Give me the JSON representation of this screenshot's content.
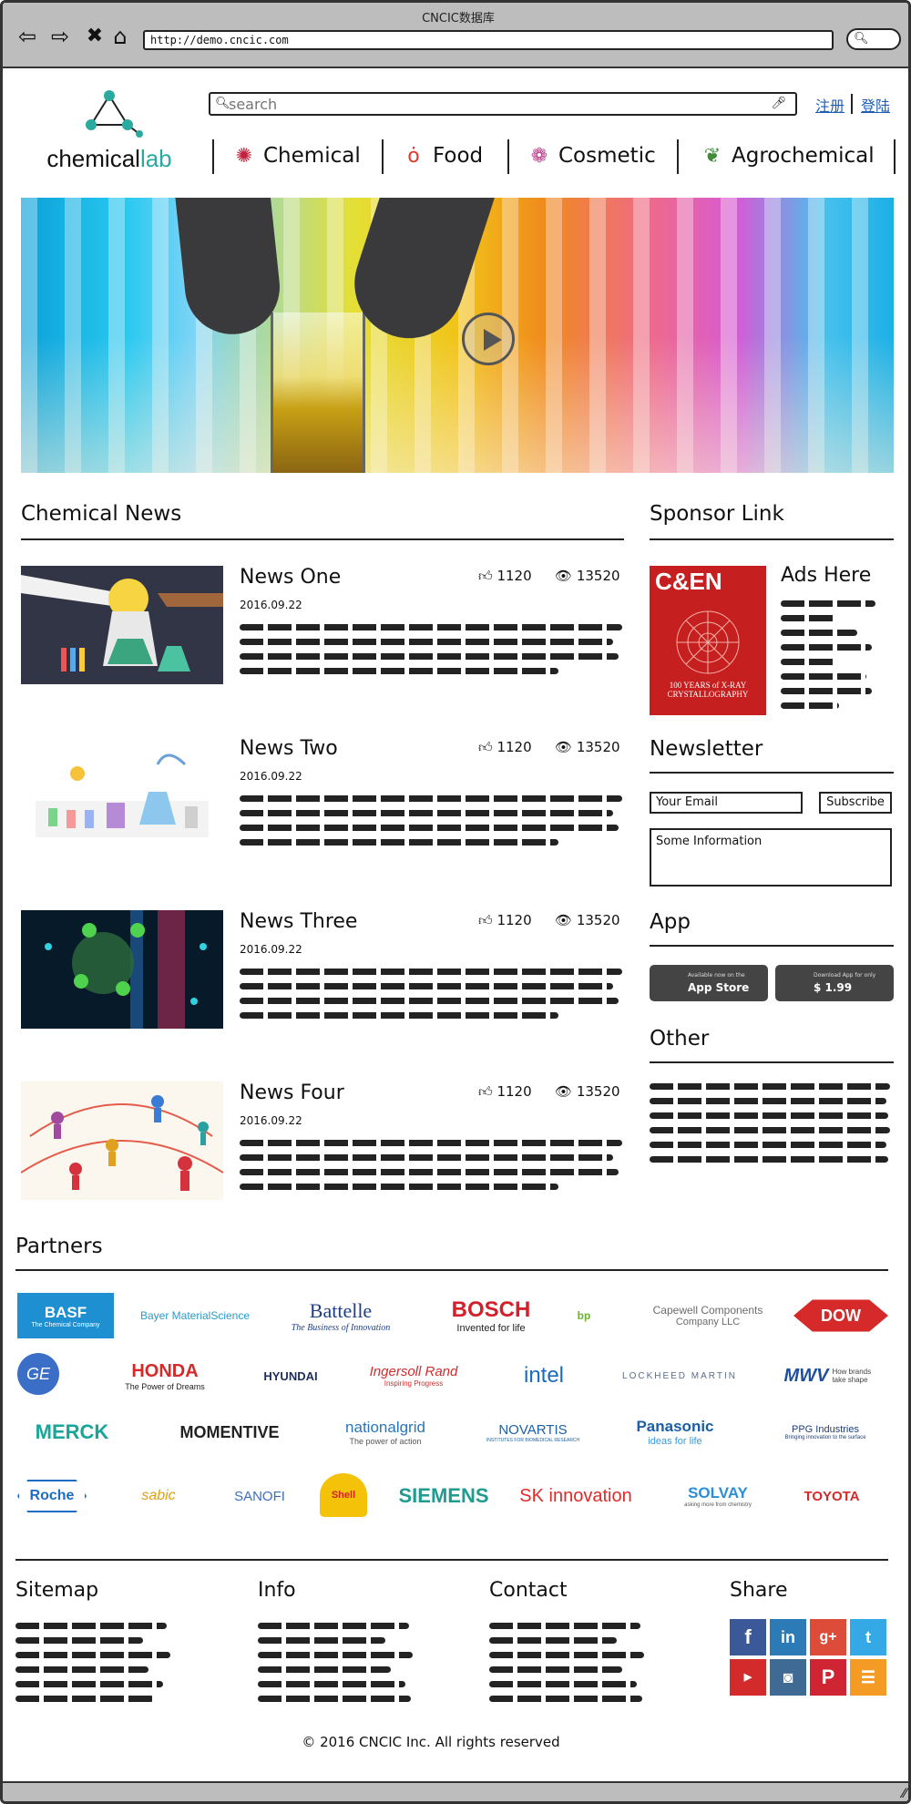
{
  "browser": {
    "title": "CNCIC数据库",
    "url": "http://demo.cncic.com"
  },
  "header": {
    "logo_prefix": "chemical",
    "logo_suffix": "lab",
    "search_placeholder": "search",
    "register": "注册",
    "login": "登陆",
    "categories": [
      {
        "label": "Chemical",
        "icon": "chemical-icon"
      },
      {
        "label": "Food",
        "icon": "food-icon"
      },
      {
        "label": "Cosmetic",
        "icon": "cosmetic-icon"
      },
      {
        "label": "Agrochemical",
        "icon": "agrochemical-icon"
      }
    ]
  },
  "hero": {
    "icon": "play-icon"
  },
  "news": {
    "title": "Chemical News",
    "items": [
      {
        "title": "News One",
        "date": "2016.09.22",
        "likes": "1120",
        "views": "13520"
      },
      {
        "title": "News Two",
        "date": "2016.09.22",
        "likes": "1120",
        "views": "13520"
      },
      {
        "title": "News Three",
        "date": "2016.09.22",
        "likes": "1120",
        "views": "13520"
      },
      {
        "title": "News Four",
        "date": "2016.09.22",
        "likes": "1120",
        "views": "13520"
      }
    ]
  },
  "sidebar": {
    "sponsor_title": "Sponsor Link",
    "ad_title": "Ads Here",
    "ad_image_heading": "C&EN",
    "ad_image_caption": "100 YEARS of X-RAY CRYSTALLOGRAPHY",
    "newsletter_title": "Newsletter",
    "email_placeholder": "Your Email",
    "subscribe": "Subscribe",
    "info_placeholder": "Some Information",
    "app_title": "App",
    "appstore_small": "Available now on the",
    "appstore_big": "App Store",
    "download_small": "Download App for only",
    "download_big": "$ 1.99",
    "other_title": "Other"
  },
  "partners": {
    "title": "Partners",
    "rows": [
      [
        "BASF",
        "Bayer MaterialScience",
        "Battelle",
        "BOSCH",
        "bp",
        "Capewell Components",
        "DOW"
      ],
      [
        "GE",
        "HONDA",
        "HYUNDAI",
        "Ingersoll Rand",
        "intel",
        "LOCKHEED MARTIN",
        "MWV"
      ],
      [
        "MERCK",
        "MOMENTIVE",
        "nationalgrid",
        "NOVARTIS",
        "Panasonic",
        "PPG Industries"
      ],
      [
        "Roche",
        "sabic",
        "SANOFI",
        "Shell",
        "SIEMENS",
        "SK innovation",
        "SOLVAY",
        "TOYOTA"
      ]
    ],
    "taglines": {
      "basf": "The Chemical Company",
      "battelle": "The Business of Innovation",
      "bosch": "Invented for life",
      "capewell": "Company LLC",
      "honda": "The Power of Dreams",
      "ir": "Inspiring Progress",
      "mwv": "How brands take shape",
      "nationalgrid": "The power of action",
      "novartis": "INSTITUTES FOR BIOMEDICAL RESEARCH",
      "panasonic": "ideas for life",
      "ppg": "Bringing innovation to the surface",
      "solvay": "asking more from chemistry"
    }
  },
  "footer": {
    "sitemap": "Sitemap",
    "info": "Info",
    "contact": "Contact",
    "share": "Share",
    "copyright": "© 2016 CNCIC Inc. All rights reserved",
    "social": [
      "facebook-icon",
      "linkedin-icon",
      "googleplus-icon",
      "twitter-icon",
      "youtube-icon",
      "instagram-icon",
      "pinterest-icon",
      "rss-icon"
    ]
  },
  "colors": {
    "link": "#1e5fb5",
    "accent": "#2aa9a0"
  }
}
